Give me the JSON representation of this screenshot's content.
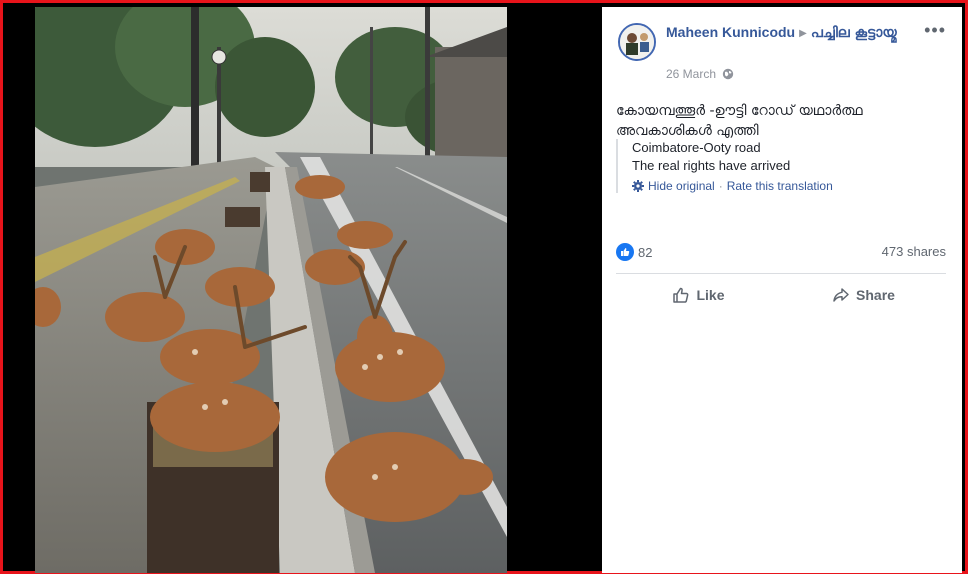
{
  "post": {
    "author": "Maheen Kunnicodu",
    "group": "പച്ചില കൂട്ടായ്മ",
    "date": "26 March",
    "text": "കോയമ്പത്തൂർ -ഊട്ടി റോഡ് യഥാർത്ഥ അവകാശികൾ എത്തി",
    "translation": {
      "line1": "Coimbatore-Ooty road",
      "line2": "The real rights have arrived",
      "hide_label": "Hide original",
      "rate_label": "Rate this translation"
    },
    "reaction_count": "82",
    "shares": "473 shares",
    "actions": {
      "like": "Like",
      "share": "Share"
    },
    "more_label": "•••"
  },
  "colors": {
    "frame": "#e8141b",
    "link": "#365899",
    "like": "#1877f2"
  },
  "icons": [
    "globe-icon",
    "gear-icon",
    "like-reaction-icon",
    "thumbs-up-icon",
    "share-arrow-icon",
    "more-icon"
  ]
}
